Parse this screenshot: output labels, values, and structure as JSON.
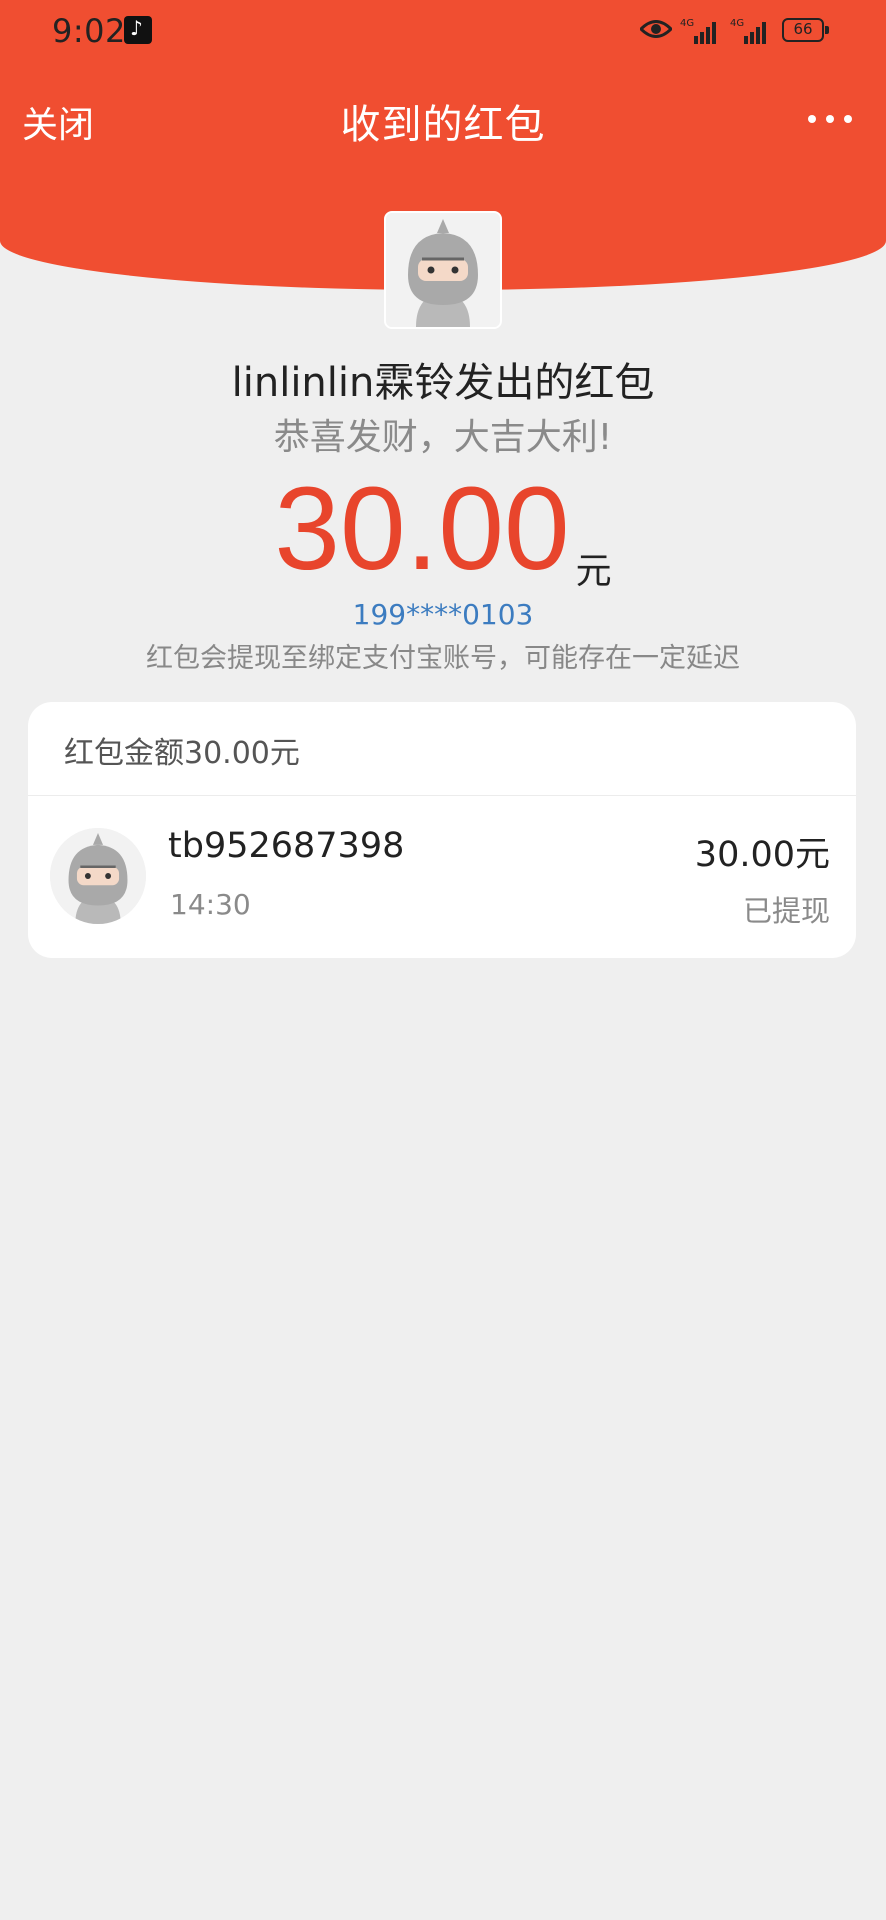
{
  "status_bar": {
    "time": "9:02",
    "battery": "66",
    "network_1": "4G",
    "network_2": "4G"
  },
  "nav": {
    "close_label": "关闭",
    "title": "收到的红包"
  },
  "envelope": {
    "sender": "linlinlin霖铃发出的红包",
    "blessing": "恭喜发财，大吉大利!",
    "amount": "30.00",
    "unit": "元",
    "account": "199****0103",
    "notice": "红包会提现至绑定支付宝账号，可能存在一定延迟"
  },
  "card": {
    "title": "红包金额30.00元",
    "records": [
      {
        "name": "tb952687398",
        "time": "14:30",
        "amount": "30.00元",
        "status": "已提现"
      }
    ]
  },
  "colors": {
    "header_red": "#f04e31",
    "amount_red": "#e8452c",
    "link_blue": "#3c7cc0",
    "background": "#efefef"
  }
}
